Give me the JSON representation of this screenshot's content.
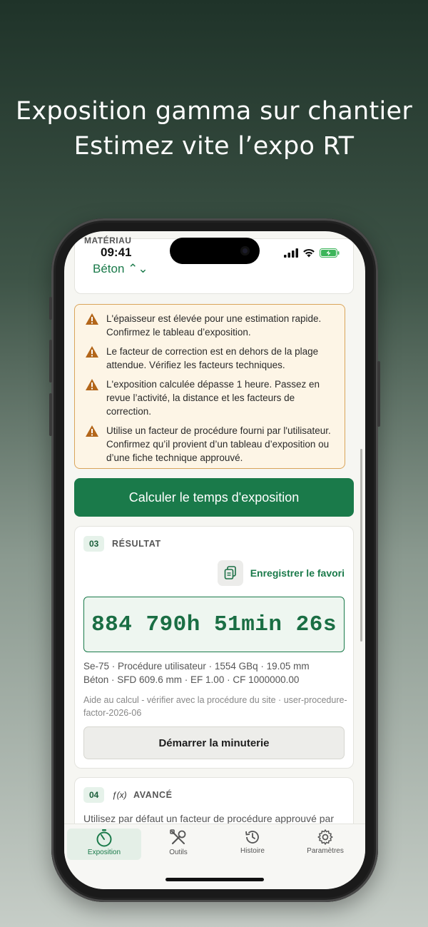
{
  "hero": {
    "line1": "Exposition gamma sur chantier",
    "line2": "Estimez vite l’expo RT"
  },
  "status": {
    "time": "09:41",
    "material_label": "MATÉRIAU",
    "material_value": "Béton ⌃⌄"
  },
  "warnings": [
    "L'épaisseur est élevée pour une estimation rapide. Confirmez le tableau d’exposition.",
    "Le facteur de correction est en dehors de la plage attendue. Vérifiez les facteurs techniques.",
    "L'exposition calculée dépasse 1 heure. Passez en revue l’activité, la distance et les facteurs de correction.",
    "Utilise un facteur de procédure fourni par l'utilisateur. Confirmez qu’il provient d’un tableau d’exposition ou d’une fiche technique approuvé."
  ],
  "calculate_label": "Calculer le temps d'exposition",
  "result": {
    "step": "03",
    "title": "RÉSULTAT",
    "favorite_label": "Enregistrer le favori",
    "value": "884 790h 51min 26s",
    "details_line1": "Se-75 · Procédure utilisateur · 1554 GBq · 19.05 mm",
    "details_line2": "Béton · SFD 609.6 mm · EF 1.00 · CF 1000000.00",
    "note": "Aide au calcul - vérifier avec la procédure du site · user-procedure-factor-2026-06",
    "timer_label": "Démarrer la minuterie"
  },
  "advanced": {
    "step": "04",
    "icon_text": "ƒ(x)",
    "title": "AVANCÉ",
    "description": "Utilisez par défaut un facteur de procédure approuvé par"
  },
  "tabs": [
    {
      "label": "Exposition",
      "icon": "timer-icon"
    },
    {
      "label": "Outils",
      "icon": "tools-icon"
    },
    {
      "label": "Histoire",
      "icon": "history-icon"
    },
    {
      "label": "Paramètres",
      "icon": "gear-icon"
    }
  ],
  "colors": {
    "accent": "#1a7a4a",
    "warning": "#d9a45a",
    "warning_bg": "#fdf5e6"
  }
}
